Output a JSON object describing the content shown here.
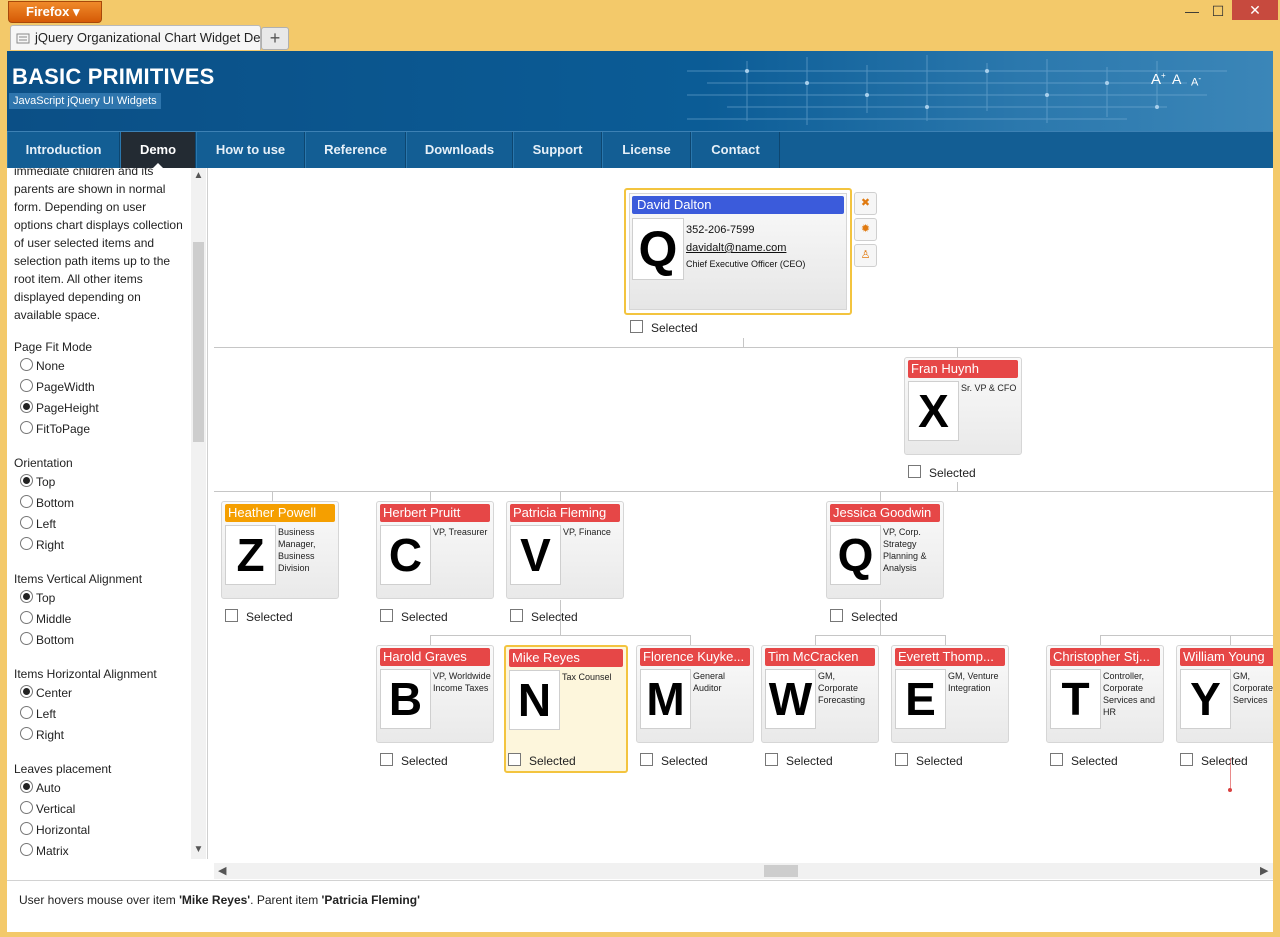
{
  "browser": {
    "app_button": "Firefox",
    "tab_title": "jQuery Organizational Chart Widget Demo",
    "new_tab": "+",
    "min": "—",
    "max": "☐",
    "close": "✕"
  },
  "site": {
    "brand": "BASIC PRIMITIVES",
    "subtitle": "JavaScript jQuery UI Widgets",
    "font_large": "A",
    "font_medium": "A",
    "font_small": "A"
  },
  "nav": [
    "Introduction",
    "Demo",
    "How to use",
    "Reference",
    "Downloads",
    "Support",
    "License",
    "Contact"
  ],
  "left_panel": {
    "description": "immediate children and its parents are shown in normal form. Depending on user options chart displays collection of user selected items and selection path items up to the root item. All other items displayed depending on available space.",
    "page_fit_mode": {
      "label": "Page Fit Mode",
      "options": [
        "None",
        "PageWidth",
        "PageHeight",
        "FitToPage"
      ],
      "selected": "PageHeight"
    },
    "orientation": {
      "label": "Orientation",
      "options": [
        "Top",
        "Bottom",
        "Left",
        "Right"
      ],
      "selected": "Top"
    },
    "vertical_alignment": {
      "label": "Items Vertical Alignment",
      "options": [
        "Top",
        "Middle",
        "Bottom"
      ],
      "selected": "Top"
    },
    "horizontal_alignment": {
      "label": "Items Horizontal Alignment",
      "options": [
        "Center",
        "Left",
        "Right"
      ],
      "selected": "Center"
    },
    "leaves_placement": {
      "label": "Leaves placement",
      "options": [
        "Auto",
        "Vertical",
        "Horizontal",
        "Matrix"
      ],
      "selected": "Auto"
    }
  },
  "chart": {
    "selected_label": "Selected",
    "root": {
      "name": "David Dalton",
      "phone": "352-206-7599",
      "email": "davidalt@name.com",
      "position": "Chief Executive Officer (CEO)",
      "letter": "Q",
      "color": "#3b5bdb"
    },
    "nodes": [
      {
        "name": "Fran Huynh",
        "position": "Sr. VP & CFO",
        "letter": "X",
        "color": "#e64747"
      },
      {
        "name": "Heather Powell",
        "position": "Business Manager, Business Division",
        "letter": "Z",
        "color": "#f59f00"
      },
      {
        "name": "Herbert Pruitt",
        "position": "VP, Treasurer",
        "letter": "C",
        "color": "#e64747"
      },
      {
        "name": "Patricia Fleming",
        "position": "VP, Finance",
        "letter": "V",
        "color": "#e64747"
      },
      {
        "name": "Jessica Goodwin",
        "position": "VP, Corp. Strategy Planning & Analysis",
        "letter": "Q",
        "color": "#e64747"
      },
      {
        "name": "Harold Graves",
        "position": "VP, Worldwide Income Taxes",
        "letter": "B",
        "color": "#e64747"
      },
      {
        "name": "Mike Reyes",
        "position": "Tax Counsel",
        "letter": "N",
        "color": "#e64747"
      },
      {
        "name": "Florence Kuyke...",
        "position": "General Auditor",
        "letter": "M",
        "color": "#e64747"
      },
      {
        "name": "Tim McCracken",
        "position": "GM, Corporate Forecasting",
        "letter": "W",
        "color": "#e64747"
      },
      {
        "name": "Everett Thomp...",
        "position": "GM, Venture Integration",
        "letter": "E",
        "color": "#e64747"
      },
      {
        "name": "Christopher Stj...",
        "position": "Controller, Corporate Services and HR",
        "letter": "T",
        "color": "#e64747"
      },
      {
        "name": "William Young",
        "position": "GM, Corporate Services",
        "letter": "Y",
        "color": "#e64747"
      }
    ]
  },
  "status": {
    "prefix": "User hovers mouse over item ",
    "item": "'Mike Reyes'",
    "middle": ". Parent item ",
    "parent": "'Patricia Fleming'"
  }
}
